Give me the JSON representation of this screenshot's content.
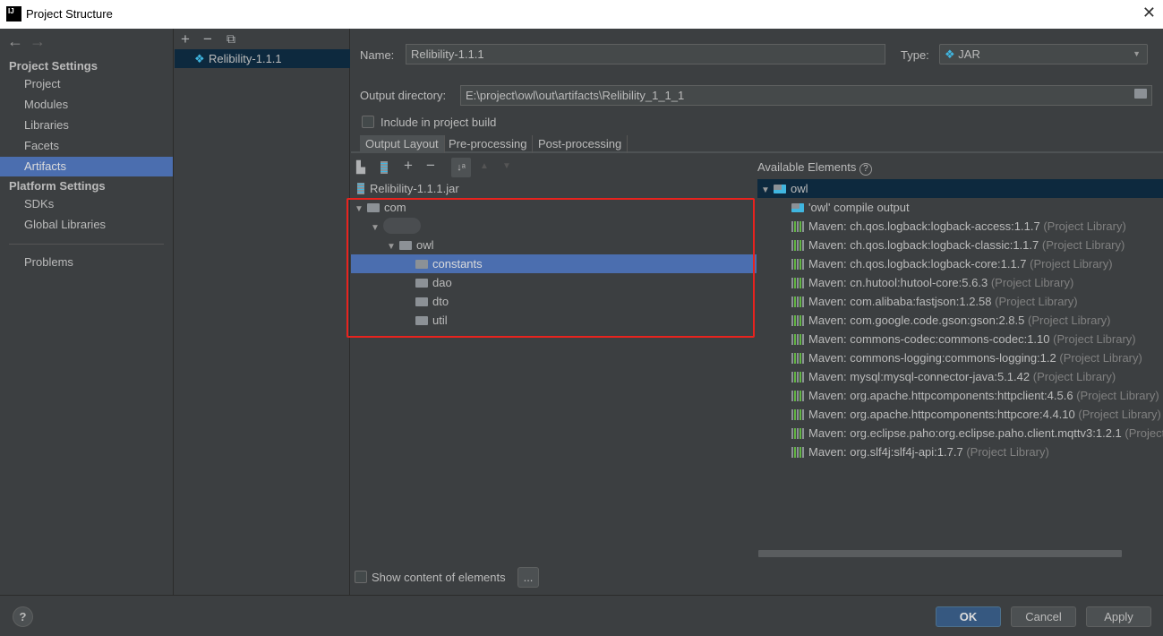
{
  "window": {
    "title": "Project Structure",
    "logo": "IJ"
  },
  "sidebar": {
    "project_settings": "Project Settings",
    "items": [
      {
        "label": "Project"
      },
      {
        "label": "Modules"
      },
      {
        "label": "Libraries"
      },
      {
        "label": "Facets"
      },
      {
        "label": "Artifacts",
        "selected": true
      }
    ],
    "platform_settings": "Platform Settings",
    "platform_items": [
      {
        "label": "SDKs"
      },
      {
        "label": "Global Libraries"
      }
    ],
    "problems": "Problems"
  },
  "artifacts": {
    "items": [
      "Relibility-1.1.1"
    ]
  },
  "form": {
    "name_label": "Name:",
    "name_value": "Relibility-1.1.1",
    "type_label": "Type:",
    "type_value": "JAR",
    "output_label": "Output directory:",
    "output_value": "E:\\project\\owl\\out\\artifacts\\Relibility_1_1_1",
    "include_label": "Include in project build",
    "include_checked": false
  },
  "tabs": [
    "Output Layout",
    "Pre-processing",
    "Post-processing"
  ],
  "layout_tree": [
    {
      "label": "Relibility-1.1.1.jar",
      "depth": 0,
      "icon": "jar-icon"
    },
    {
      "label": "com",
      "depth": 0,
      "icon": "folder-icon",
      "expanded": true
    },
    {
      "label": "",
      "depth": 1,
      "icon": "blurred",
      "expanded": true
    },
    {
      "label": "owl",
      "depth": 2,
      "icon": "folder-icon",
      "expanded": true
    },
    {
      "label": "constants",
      "depth": 3,
      "icon": "folder-icon",
      "selected": true
    },
    {
      "label": "dao",
      "depth": 3,
      "icon": "folder-icon"
    },
    {
      "label": "dto",
      "depth": 3,
      "icon": "folder-icon"
    },
    {
      "label": "util",
      "depth": 3,
      "icon": "folder-icon"
    }
  ],
  "available": {
    "title": "Available Elements",
    "root": "owl",
    "items": [
      {
        "name": "'owl' compile output",
        "suffix": "",
        "icon": "module-output-icon"
      },
      {
        "name": "Maven: ch.qos.logback:logback-access:1.1.7",
        "suffix": "(Project Library)"
      },
      {
        "name": "Maven: ch.qos.logback:logback-classic:1.1.7",
        "suffix": "(Project Library)"
      },
      {
        "name": "Maven: ch.qos.logback:logback-core:1.1.7",
        "suffix": "(Project Library)"
      },
      {
        "name": "Maven: cn.hutool:hutool-core:5.6.3",
        "suffix": "(Project Library)"
      },
      {
        "name": "Maven: com.alibaba:fastjson:1.2.58",
        "suffix": "(Project Library)"
      },
      {
        "name": "Maven: com.google.code.gson:gson:2.8.5",
        "suffix": "(Project Library)"
      },
      {
        "name": "Maven: commons-codec:commons-codec:1.10",
        "suffix": "(Project Library)"
      },
      {
        "name": "Maven: commons-logging:commons-logging:1.2",
        "suffix": "(Project Library)"
      },
      {
        "name": "Maven: mysql:mysql-connector-java:5.1.42",
        "suffix": "(Project Library)"
      },
      {
        "name": "Maven: org.apache.httpcomponents:httpclient:4.5.6",
        "suffix": "(Project Library)"
      },
      {
        "name": "Maven: org.apache.httpcomponents:httpcore:4.4.10",
        "suffix": "(Project Library)"
      },
      {
        "name": "Maven: org.eclipse.paho:org.eclipse.paho.client.mqttv3:1.2.1",
        "suffix": "(Project"
      },
      {
        "name": "Maven: org.slf4j:slf4j-api:1.7.7",
        "suffix": "(Project Library)"
      }
    ]
  },
  "show_content": {
    "label": "Show content of elements",
    "checked": false,
    "more": "..."
  },
  "footer": {
    "help": "?",
    "ok": "OK",
    "cancel": "Cancel",
    "apply": "Apply"
  },
  "colors": {
    "selection": "#4b6eaf",
    "highlight_box": "#e8231e",
    "ok_button": "#365880"
  }
}
